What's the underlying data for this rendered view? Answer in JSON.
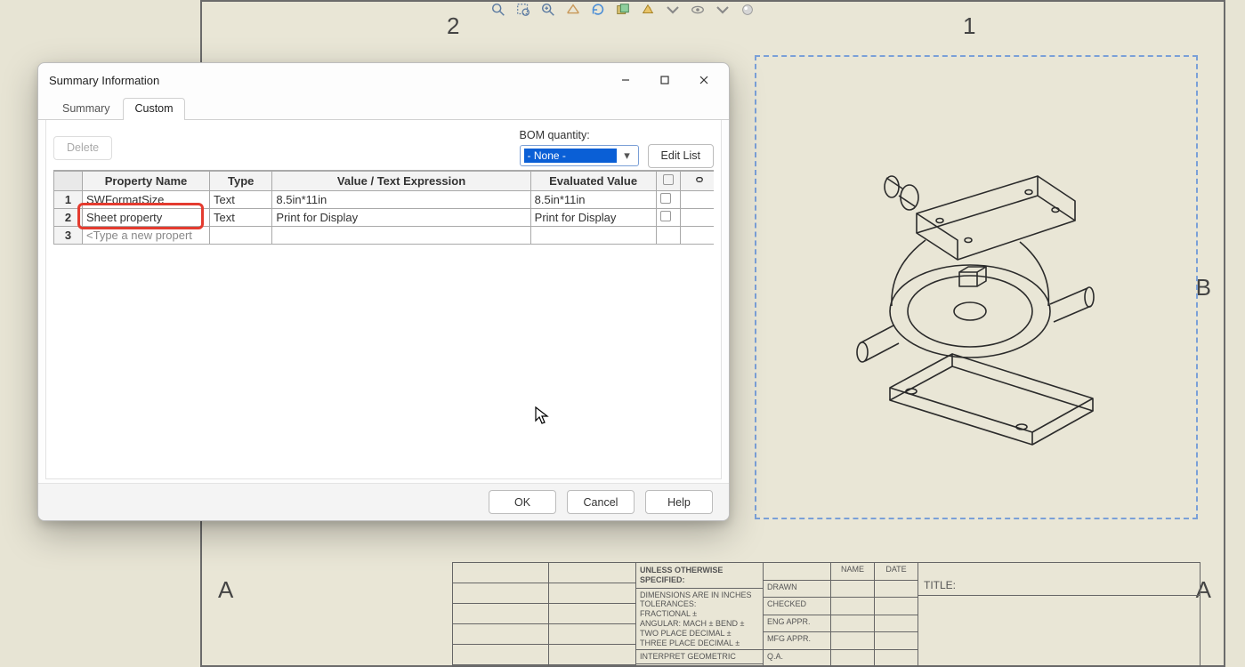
{
  "dialog": {
    "title": "Summary Information",
    "tabs": {
      "summary": "Summary",
      "custom": "Custom"
    },
    "delete": "Delete",
    "bom_label": "BOM quantity:",
    "bom_value": "- None -",
    "edit_list": "Edit List",
    "columns": {
      "name": "Property Name",
      "type": "Type",
      "value": "Value / Text Expression",
      "eval": "Evaluated Value"
    },
    "rows": [
      {
        "n": "1",
        "name": "SWFormatSize",
        "type": "Text",
        "value": "8.5in*11in",
        "eval": "8.5in*11in"
      },
      {
        "n": "2",
        "name": "Sheet property",
        "type": "Text",
        "value": "Print for Display",
        "eval": "Print for Display"
      },
      {
        "n": "3",
        "name": "<Type a new propert",
        "type": "",
        "value": "",
        "eval": ""
      }
    ],
    "buttons": {
      "ok": "OK",
      "cancel": "Cancel",
      "help": "Help"
    }
  },
  "drawing": {
    "ruler_2": "2",
    "ruler_1": "1",
    "ruler_B": "B",
    "ruler_A": "A",
    "titleblock": {
      "spec_header": "UNLESS OTHERWISE SPECIFIED:",
      "spec_l1": "DIMENSIONS ARE IN INCHES",
      "spec_l2": "TOLERANCES:",
      "spec_l3": "FRACTIONAL ±",
      "spec_l4": "ANGULAR: MACH ±    BEND  ±",
      "spec_l5": "TWO PLACE DECIMAL   ±",
      "spec_l6": "THREE PLACE DECIMAL  ±",
      "spec_l7": "INTERPRET GEOMETRIC",
      "name": "NAME",
      "date": "DATE",
      "drawn": "DRAWN",
      "checked": "CHECKED",
      "engappr": "ENG APPR.",
      "mfgappr": "MFG APPR.",
      "qa": "Q.A.",
      "title_lbl": "TITLE:"
    }
  },
  "icons": {
    "zoom_fit": "zoom-fit-icon",
    "zoom_area": "zoom-area-icon",
    "zoom_prev": "zoom-previous-icon",
    "section": "section-view-icon",
    "rotate": "rotate-view-icon",
    "display": "display-style-icon",
    "shade": "shaded-icon",
    "hide": "hide-show-icon",
    "appear": "appearance-icon"
  }
}
